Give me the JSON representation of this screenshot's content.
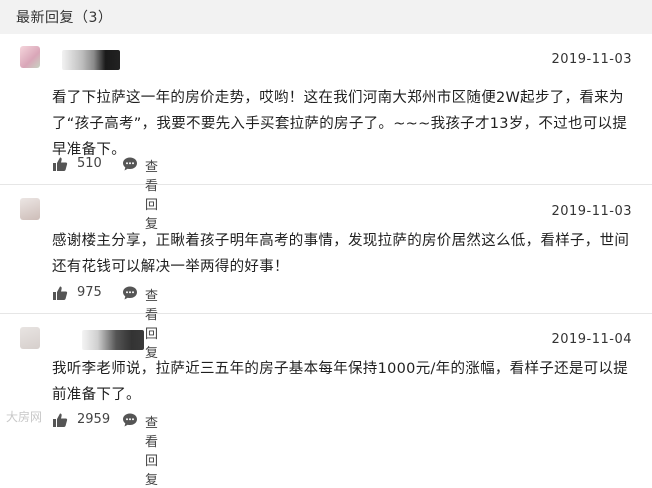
{
  "header": {
    "title": "最新回复（3）"
  },
  "comments": [
    {
      "date": "2019-11-03",
      "text": "看了下拉萨这一年的房价走势，哎哟！这在我们河南大郑州市区随便2W起步了，看来为了“孩子高考”，我要不要先入手买套拉萨的房子了。~~~我孩子才13岁，不过也可以提早准备下。",
      "likes": "510",
      "reply_label": "查看回复"
    },
    {
      "date": "2019-11-03",
      "text": "感谢楼主分享，正瞅着孩子明年高考的事情，发现拉萨的房价居然这么低，看样子，世间还有花钱可以解决一举两得的好事！",
      "likes": "975",
      "reply_label": "查看回复"
    },
    {
      "date": "2019-11-04",
      "text": "我听李老师说，拉萨近三五年的房子基本每年保持1000元/年的涨幅，看样子还是可以提前准备下了。",
      "likes": "2959",
      "reply_label": "查看回复"
    }
  ],
  "watermark": "大房网"
}
